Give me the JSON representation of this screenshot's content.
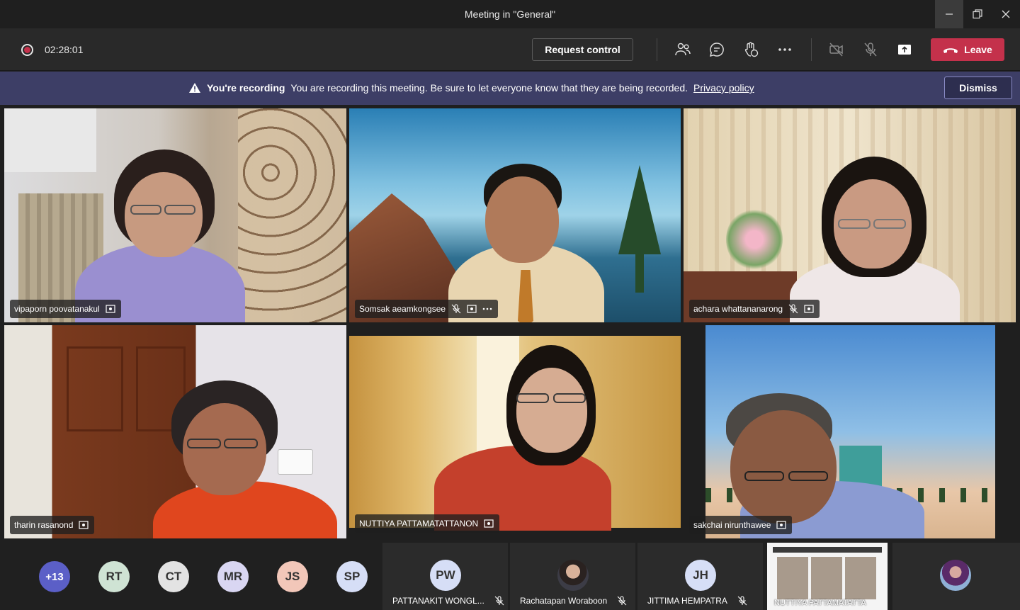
{
  "window": {
    "title": "Meeting in \"General\""
  },
  "toolbar": {
    "timer": "02:28:01",
    "request_control_label": "Request control",
    "leave_label": "Leave"
  },
  "banner": {
    "heading": "You're recording",
    "message": "You are recording this meeting. Be sure to let everyone know that they are being recorded.",
    "link": "Privacy policy",
    "dismiss_label": "Dismiss"
  },
  "participants": [
    {
      "name": "vipaporn poovatanakul"
    },
    {
      "name": "Somsak aeamkongsee"
    },
    {
      "name": "achara whattananarong"
    },
    {
      "name": "tharin rasanond"
    },
    {
      "name": "NUTTIYA PATTAMATATTANON"
    },
    {
      "name": "sakchai nirunthawee"
    }
  ],
  "roster": {
    "overflow": "+13",
    "initials": [
      "RT",
      "CT",
      "MR",
      "JS",
      "SP"
    ],
    "initial_colors": [
      "#c8d0f0",
      "#cfe3d4",
      "#e3e3e3",
      "#d9d6f2",
      "#f2c7b9",
      "#d6def6"
    ],
    "tiles": [
      {
        "initials": "PW",
        "name": "PATTANAKIT WONGL..."
      },
      {
        "name": "Rachatapan Woraboon"
      },
      {
        "initials": "JH",
        "name": "JITTIMA HEMPATRA"
      },
      {
        "name": "NUTTIYA PATTAMATATTA"
      }
    ]
  }
}
